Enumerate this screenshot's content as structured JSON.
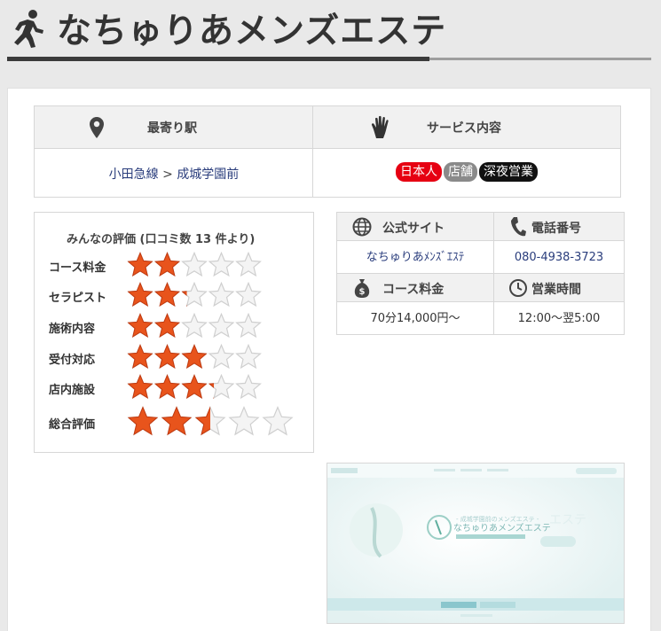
{
  "header": {
    "title": "なちゅりあメンズエステ",
    "icon": "running-person-icon"
  },
  "info": {
    "station_header": "最寄り駅",
    "service_header": "サービス内容",
    "station_line": "小田急線",
    "station_separator": ">",
    "station_name": "成城学園前",
    "tags": [
      {
        "label": "日本人",
        "color": "#e60012"
      },
      {
        "label": "店舗",
        "color": "#8a8a8a"
      },
      {
        "label": "深夜営業",
        "color": "#111111"
      }
    ]
  },
  "ratings": {
    "title": "みんなの評価 (口コミ数 13 件より)",
    "items": [
      {
        "label": "コース料金",
        "score": 2
      },
      {
        "label": "セラピスト",
        "score": 2.2
      },
      {
        "label": "施術内容",
        "score": 2
      },
      {
        "label": "受付対応",
        "score": 3
      },
      {
        "label": "店内施設",
        "score": 3.2
      },
      {
        "label": "総合評価",
        "score": 2.5
      }
    ],
    "max": 5,
    "star_color": "#e8541c"
  },
  "contact": {
    "website_header": "公式サイト",
    "phone_header": "電話番号",
    "website_value": "なちゅりあﾒﾝｽﾞｴｽﾃ",
    "phone_value": "080-4938-3723",
    "price_header": "コース料金",
    "hours_header": "営業時間",
    "price_value": "70分14,000円～",
    "hours_value": "12:00～翌5:00"
  },
  "thumbnail": {
    "caption": "なちゅりあメンズエステ"
  }
}
